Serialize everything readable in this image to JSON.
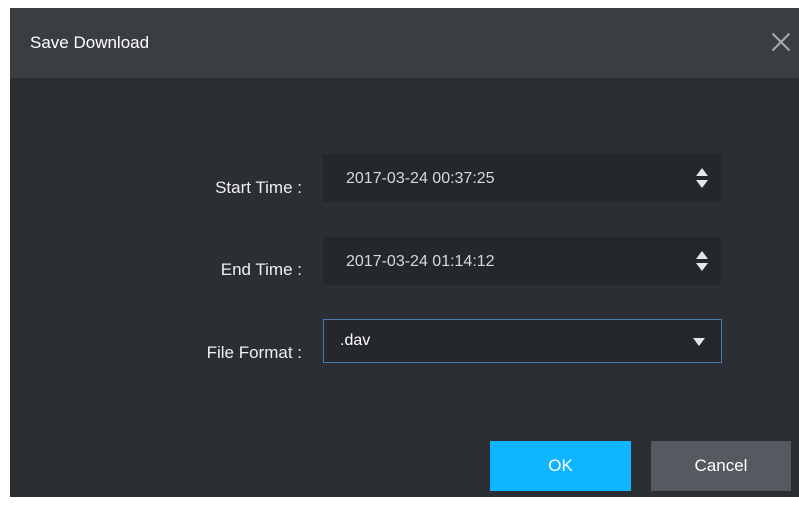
{
  "dialog": {
    "title": "Save Download",
    "close_icon": "close-icon"
  },
  "form": {
    "start_time": {
      "label": "Start Time :",
      "value": "2017-03-24 00:37:25",
      "spinner_icon": "up-down-arrows-icon"
    },
    "end_time": {
      "label": "End Time :",
      "value": "2017-03-24 01:14:12",
      "spinner_icon": "up-down-arrows-icon"
    },
    "file_format": {
      "label": "File Format :",
      "selected": ".dav",
      "caret_icon": "chevron-down-icon"
    }
  },
  "buttons": {
    "ok_label": "OK",
    "cancel_label": "Cancel"
  },
  "colors": {
    "dialog_bg": "#2b2e33",
    "titlebar_bg": "#3a3d42",
    "field_bg": "#24272b",
    "ok_bg": "#0fb6ff",
    "cancel_bg": "#555960",
    "select_border": "#4a7bb0"
  }
}
